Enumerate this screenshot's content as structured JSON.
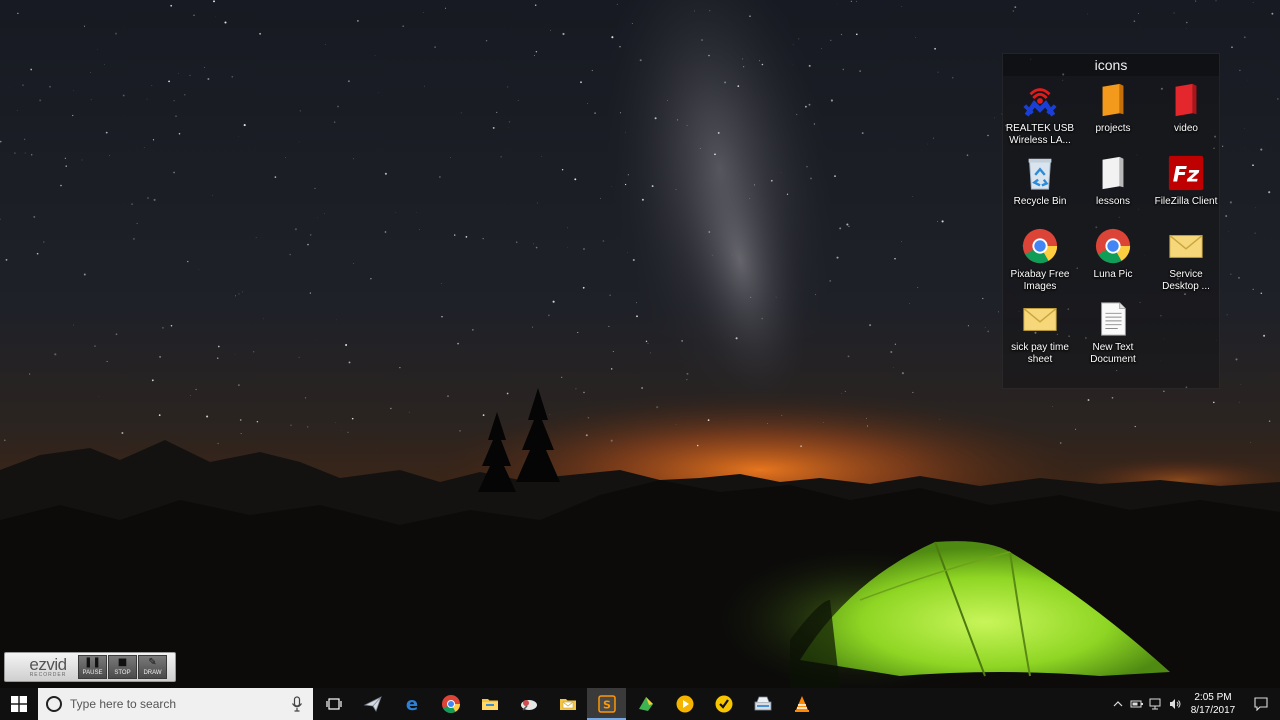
{
  "fence": {
    "title": "icons",
    "icons": [
      {
        "label": "REALTEK USB Wireless LA...",
        "icon": "wireless-adapter-icon"
      },
      {
        "label": "projects",
        "icon": "orange-folder-icon"
      },
      {
        "label": "video",
        "icon": "red-folder-icon"
      },
      {
        "label": "Recycle Bin",
        "icon": "recycle-bin-icon"
      },
      {
        "label": "lessons",
        "icon": "white-folder-icon"
      },
      {
        "label": "FileZilla Client",
        "icon": "filezilla-icon"
      },
      {
        "label": "Pixabay Free Images",
        "icon": "chrome-icon"
      },
      {
        "label": "Luna Pic",
        "icon": "chrome-icon"
      },
      {
        "label": "Service Desktop ...",
        "icon": "envelope-icon"
      },
      {
        "label": "sick pay time sheet",
        "icon": "envelope-icon"
      },
      {
        "label": "New Text Document",
        "icon": "text-document-icon"
      }
    ]
  },
  "ezvid": {
    "logo": "ezvid",
    "logo_sub": "RECORDER",
    "pause": "PAUSE",
    "stop": "STOP",
    "draw": "DRAW"
  },
  "taskbar": {
    "search_placeholder": "Type here to search",
    "apps": [
      "task-view-icon",
      "paper-plane-icon",
      "edge-icon",
      "chrome-icon",
      "file-explorer-icon",
      "cloud-app-icon",
      "mail-folder-icon",
      "sublime-text-icon",
      "green-app-icon",
      "media-player-icon",
      "norton-icon",
      "scanner-icon",
      "vlc-icon"
    ],
    "clock": {
      "time": "2:05 PM",
      "date": "8/17/2017"
    }
  },
  "colors": {
    "taskbar_bg": "#101010",
    "accent_underline": "#77a8e0",
    "tent_green": "#9be22c",
    "horizon_orange": "#e8721f"
  }
}
